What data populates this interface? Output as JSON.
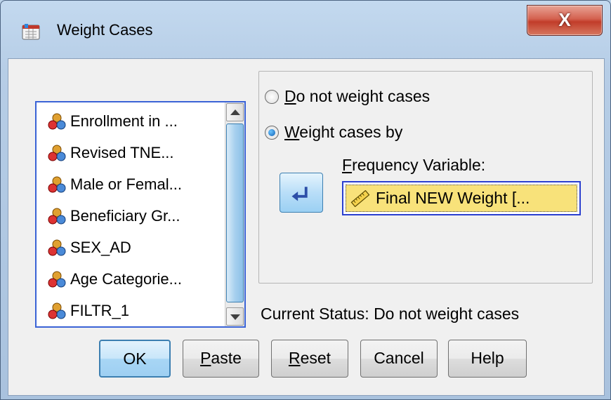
{
  "window": {
    "title": "Weight Cases",
    "close_label": "X"
  },
  "variables": [
    {
      "label": "Enrollment in ...",
      "icon": "nominal-variable-icon"
    },
    {
      "label": "Revised TNE...",
      "icon": "nominal-variable-icon"
    },
    {
      "label": "Male or Femal...",
      "icon": "nominal-variable-icon"
    },
    {
      "label": "Beneficiary Gr...",
      "icon": "nominal-variable-icon"
    },
    {
      "label": "SEX_AD",
      "icon": "nominal-variable-icon"
    },
    {
      "label": "Age Categorie...",
      "icon": "nominal-variable-icon"
    },
    {
      "label": "FILTR_1",
      "icon": "nominal-variable-icon"
    }
  ],
  "options": {
    "do_not_weight": {
      "prefix": "D",
      "rest": "o not weight cases",
      "selected": false
    },
    "weight_by": {
      "prefix": "W",
      "rest": "eight cases by",
      "selected": true
    }
  },
  "frequency": {
    "label_prefix": "F",
    "label_rest": "requency Variable:",
    "value": "Final NEW Weight [...",
    "icon": "scale-variable-icon"
  },
  "status": "Current Status: Do not weight cases",
  "buttons": {
    "ok": "OK",
    "paste_prefix": "P",
    "paste_rest": "aste",
    "reset_prefix": "R",
    "reset_rest": "eset",
    "cancel": "Cancel",
    "help": "Help"
  },
  "colors": {
    "selection_highlight": "#f8e27a",
    "focus_border": "#2a3fcf",
    "close_button": "#c13d2a"
  }
}
